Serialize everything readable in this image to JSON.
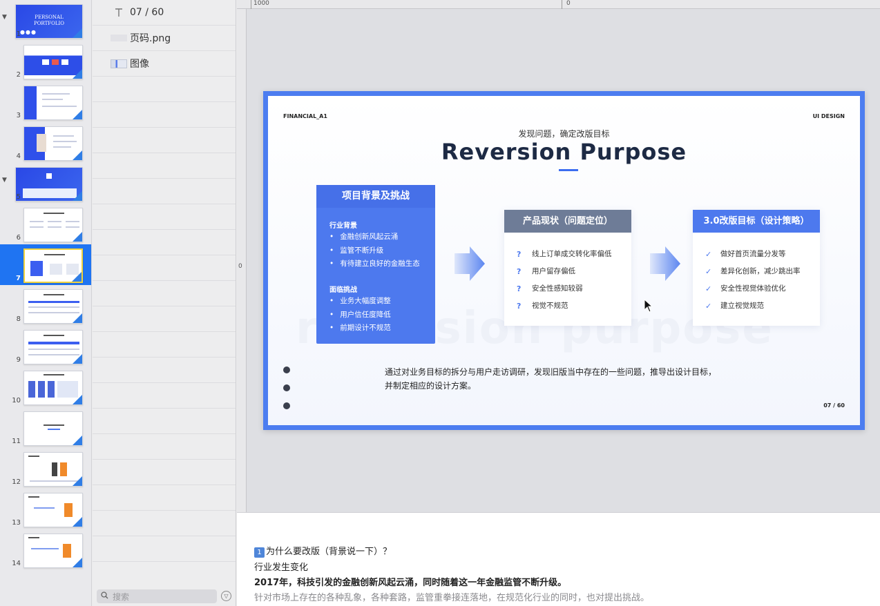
{
  "thumbnails": [
    {
      "num": "1",
      "expanded": true,
      "title_line1": "PERSONAL",
      "title_line2": "PORTFOLIO"
    },
    {
      "num": "2"
    },
    {
      "num": "3"
    },
    {
      "num": "4"
    },
    {
      "num": "5",
      "expanded": true
    },
    {
      "num": "6"
    },
    {
      "num": "7",
      "selected": true
    },
    {
      "num": "8"
    },
    {
      "num": "9"
    },
    {
      "num": "10"
    },
    {
      "num": "11"
    },
    {
      "num": "12"
    },
    {
      "num": "13"
    },
    {
      "num": "14"
    }
  ],
  "layers": [
    {
      "label": "07 / 60",
      "icon": "text-icon"
    },
    {
      "label": "页码.png",
      "icon": "blank-image-icon"
    },
    {
      "label": "图像",
      "icon": "image-icon"
    }
  ],
  "search": {
    "placeholder": "搜索"
  },
  "rulers": {
    "top_left": "1000",
    "top_mid": "0",
    "left_mid": "0"
  },
  "slide": {
    "top_left": "FINANCIAL_A1",
    "top_right": "UI DESIGN",
    "subtitle": "发现问题，确定改版目标",
    "title": "Reversion Purpose",
    "watermark": "reversion purpose",
    "box1": {
      "header": "项目背景及挑战",
      "section1": "行业背景",
      "items1": [
        "金融创新风起云涌",
        "监管不断升级",
        "有待建立良好的金融生态"
      ],
      "section2": "面临挑战",
      "items2": [
        "业务大幅度调整",
        "用户信任度降低",
        "前期设计不规范"
      ]
    },
    "box2": {
      "header": "产品现状（问题定位）",
      "marker": "?",
      "items": [
        "线上订单成交转化率偏低",
        "用户留存偏低",
        "安全性感知较弱",
        "视觉不规范"
      ]
    },
    "box3": {
      "header": "3.0改版目标（设计策略）",
      "marker": "✓",
      "items": [
        "做好首页流量分发等",
        "差异化创新，减少跳出率",
        "安全性视觉体验优化",
        "建立视觉规范"
      ]
    },
    "desc_line1": "通过对业务目标的拆分与用户走访调研，发现旧版当中存在的一些问题，推导出设计目标，",
    "desc_line2": "并制定相应的设计方案。",
    "page_num": "07 / 60",
    "accent": "#4d79ee",
    "frame_color": "#4c7df0"
  },
  "notes": {
    "badge": "1",
    "line1": "为什么要改版（背景说一下）？",
    "line2": "行业发生变化",
    "line3": "2017年，科技引发的金融创新风起云涌，同时随着这一年金融监管不断升级。",
    "line4": "针对市场上存在的各种乱象，各种套路，监管重拳接连落地，在规范化行业的同时，也对提出挑战。"
  }
}
